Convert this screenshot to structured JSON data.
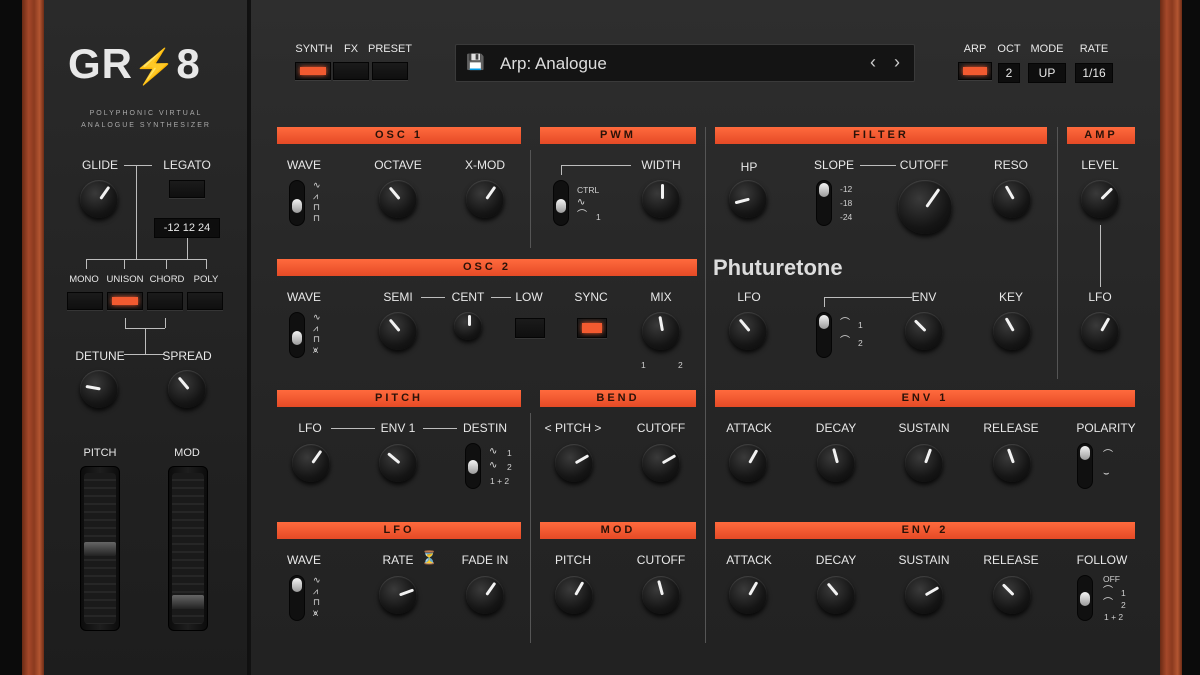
{
  "brand": {
    "logo": "GR-8",
    "subtitle_line1": "POLYPHONIC VIRTUAL",
    "subtitle_line2": "ANALOGUE SYNTHESIZER"
  },
  "sidebar": {
    "glide": "GLIDE",
    "legato": "LEGATO",
    "legato_values": "-12 12 24",
    "modes": [
      "MONO",
      "UNISON",
      "CHORD",
      "POLY"
    ],
    "active_mode": "UNISON",
    "detune": "DETUNE",
    "spread": "SPREAD",
    "pitch": "PITCH",
    "mod": "MOD"
  },
  "topbar": {
    "tabs": [
      "SYNTH",
      "FX",
      "PRESET"
    ],
    "active_tab": "SYNTH",
    "preset_name": "Arp: Analogue",
    "arp": {
      "arp_label": "ARP",
      "oct_label": "OCT",
      "mode_label": "MODE",
      "rate_label": "RATE",
      "oct_value": "2",
      "mode_value": "UP",
      "rate_value": "1/16"
    }
  },
  "sections": {
    "osc1": "OSC 1",
    "pwm": "PWM",
    "filter": "FILTER",
    "amp": "AMP",
    "osc2": "OSC 2",
    "pitch": "PITCH",
    "bend": "BEND",
    "env1": "ENV 1",
    "lfo": "LFO",
    "mod": "MOD",
    "env2": "ENV 2"
  },
  "labels": {
    "osc1_wave": "WAVE",
    "osc1_octave": "OCTAVE",
    "osc1_xmod": "X-MOD",
    "pwm_width": "WIDTH",
    "pwm_ctrl": "CTRL",
    "pwm_one": "1",
    "filter_hp": "HP",
    "filter_slope": "SLOPE",
    "filter_cutoff": "CUTOFF",
    "filter_reso": "RESO",
    "slope_opts": [
      "-12",
      "-18",
      "-24"
    ],
    "amp_level": "LEVEL",
    "amp_lfo": "LFO",
    "osc2_wave": "WAVE",
    "osc2_semi": "SEMI",
    "osc2_cent": "CENT",
    "osc2_low": "LOW",
    "osc2_sync": "SYNC",
    "osc2_mix": "MIX",
    "mix_1": "1",
    "mix_2": "2",
    "preset_author": "Phuturetone",
    "filter_lfo": "LFO",
    "filter_env": "ENV",
    "filter_key": "KEY",
    "env_opt1": "1",
    "env_opt2": "2",
    "pitch_lfo": "LFO",
    "pitch_env": "ENV 1",
    "pitch_destin": "DESTIN",
    "destin_opts": [
      "1",
      "2",
      "1 + 2"
    ],
    "bend_pitch": "< PITCH >",
    "bend_cutoff": "CUTOFF",
    "env1_attack": "ATTACK",
    "env1_decay": "DECAY",
    "env1_sustain": "SUSTAIN",
    "env1_release": "RELEASE",
    "env1_polarity": "POLARITY",
    "lfo_wave": "WAVE",
    "lfo_rate": "RATE",
    "lfo_fadein": "FADE IN",
    "mod_pitch": "PITCH",
    "mod_cutoff": "CUTOFF",
    "env2_attack": "ATTACK",
    "env2_decay": "DECAY",
    "env2_sustain": "SUSTAIN",
    "env2_release": "RELEASE",
    "env2_follow": "FOLLOW",
    "follow_opts": [
      "OFF",
      "1",
      "2",
      "1 + 2"
    ]
  },
  "colors": {
    "accent": "#f25a30",
    "panel": "#262626",
    "wood": "#a5482a"
  },
  "icons": {
    "save": "floppy-disk-icon",
    "prev": "chevron-left-icon",
    "next": "chevron-right-icon",
    "metronome": "metronome-icon"
  }
}
